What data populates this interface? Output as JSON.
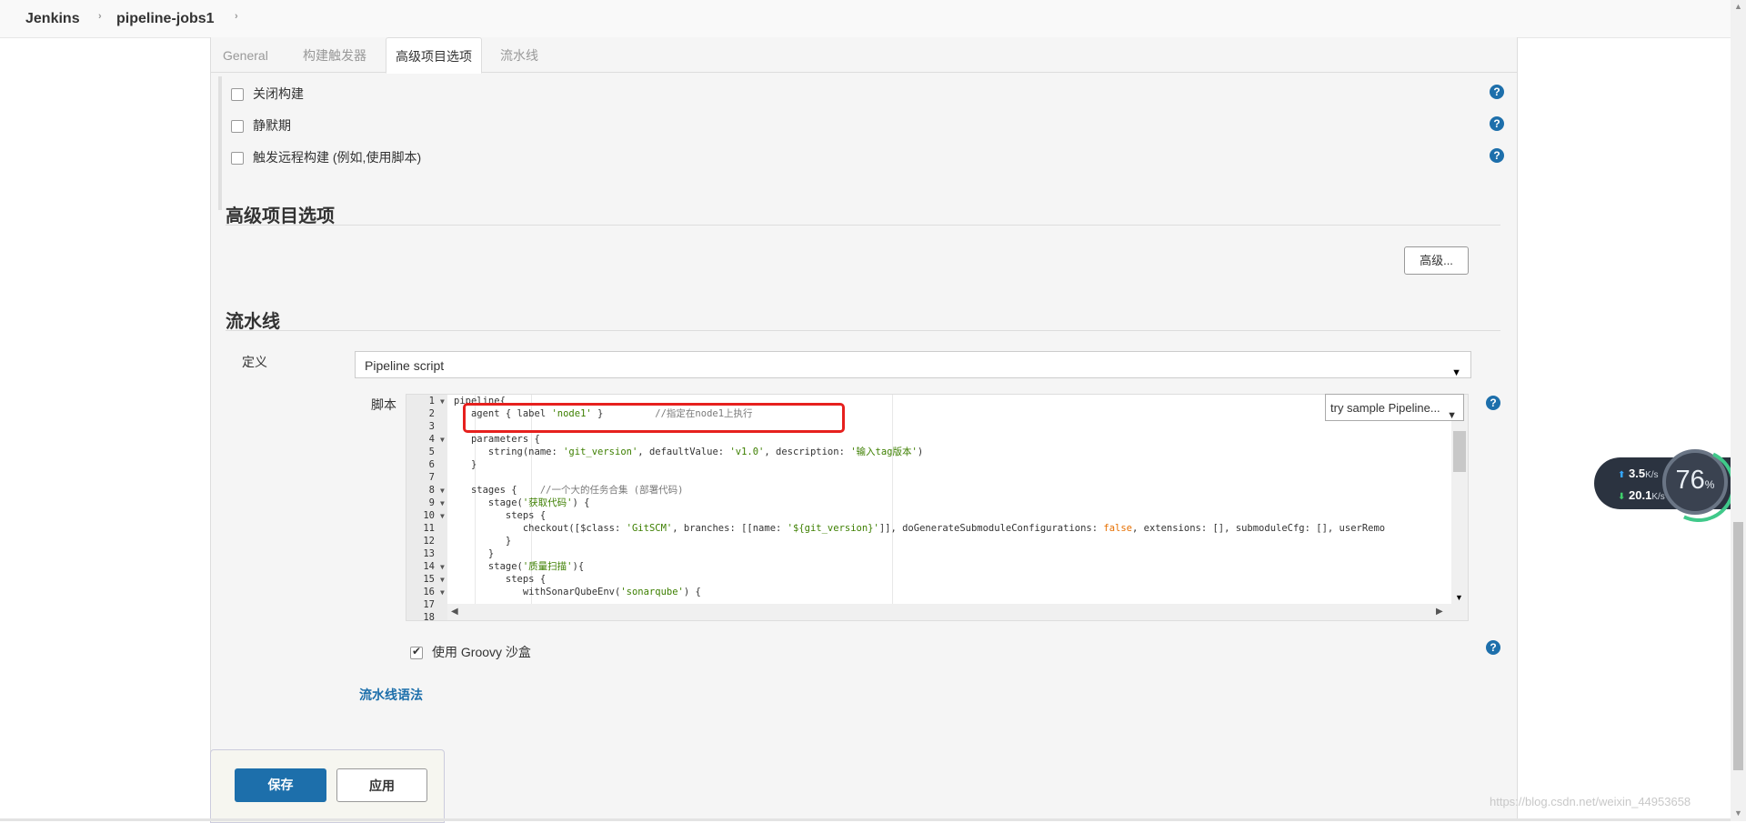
{
  "breadcrumb": {
    "items": [
      "Jenkins",
      "pipeline-jobs1"
    ]
  },
  "tabs": [
    "General",
    "构建触发器",
    "高级项目选项",
    "流水线"
  ],
  "active_tab": "高级项目选项",
  "build_triggers": {
    "options": [
      {
        "label": "关闭构建",
        "checked": false
      },
      {
        "label": "静默期",
        "checked": false
      },
      {
        "label": "触发远程构建 (例如,使用脚本)",
        "checked": false
      }
    ]
  },
  "advanced": {
    "title": "高级项目选项",
    "button": "高级..."
  },
  "pipeline": {
    "title": "流水线",
    "definition_label": "定义",
    "definition_value": "Pipeline script",
    "script_label": "脚本",
    "sample_select": "try sample Pipeline...",
    "code_lines": [
      {
        "n": "1",
        "fold": true,
        "parts": [
          {
            "t": "pipeline{"
          }
        ]
      },
      {
        "n": "2",
        "fold": false,
        "parts": [
          {
            "t": "   agent { label "
          },
          {
            "t": "'node1'",
            "c": "str"
          },
          {
            "t": " }         "
          },
          {
            "t": "//指定在node1上执行",
            "c": "cmt"
          }
        ]
      },
      {
        "n": "3",
        "fold": false,
        "parts": [
          {
            "t": ""
          }
        ]
      },
      {
        "n": "4",
        "fold": true,
        "parts": [
          {
            "t": "   parameters {"
          }
        ]
      },
      {
        "n": "5",
        "fold": false,
        "parts": [
          {
            "t": "      string(name: "
          },
          {
            "t": "'git_version'",
            "c": "str"
          },
          {
            "t": ", defaultValue: "
          },
          {
            "t": "'v1.0'",
            "c": "str"
          },
          {
            "t": ", description: "
          },
          {
            "t": "'输入tag版本'",
            "c": "str"
          },
          {
            "t": ")"
          }
        ]
      },
      {
        "n": "6",
        "fold": false,
        "parts": [
          {
            "t": "   }"
          }
        ]
      },
      {
        "n": "7",
        "fold": false,
        "parts": [
          {
            "t": ""
          }
        ]
      },
      {
        "n": "8",
        "fold": true,
        "parts": [
          {
            "t": "   stages {    "
          },
          {
            "t": "//一个大的任务合集 (部署代码)",
            "c": "cmt"
          }
        ]
      },
      {
        "n": "9",
        "fold": true,
        "parts": [
          {
            "t": "      stage("
          },
          {
            "t": "'获取代码'",
            "c": "str"
          },
          {
            "t": ") {"
          }
        ]
      },
      {
        "n": "10",
        "fold": true,
        "parts": [
          {
            "t": "         steps {"
          }
        ]
      },
      {
        "n": "11",
        "fold": false,
        "parts": [
          {
            "t": "            checkout([$class: "
          },
          {
            "t": "'GitSCM'",
            "c": "str"
          },
          {
            "t": ", branches: [[name: "
          },
          {
            "t": "'${git_version}'",
            "c": "str"
          },
          {
            "t": "]], doGenerateSubmoduleConfigurations: "
          },
          {
            "t": "false",
            "c": "kw"
          },
          {
            "t": ", extensions: [], submoduleCfg: [], userRemo"
          }
        ]
      },
      {
        "n": "12",
        "fold": false,
        "parts": [
          {
            "t": "         }"
          }
        ]
      },
      {
        "n": "13",
        "fold": false,
        "parts": [
          {
            "t": "      }"
          }
        ]
      },
      {
        "n": "14",
        "fold": true,
        "parts": [
          {
            "t": "      stage("
          },
          {
            "t": "'质量扫描'",
            "c": "str"
          },
          {
            "t": "){"
          }
        ]
      },
      {
        "n": "15",
        "fold": true,
        "parts": [
          {
            "t": "         steps {"
          }
        ]
      },
      {
        "n": "16",
        "fold": true,
        "parts": [
          {
            "t": "            withSonarQubeEnv("
          },
          {
            "t": "'sonarqube'",
            "c": "str"
          },
          {
            "t": ") {"
          }
        ]
      },
      {
        "n": "17",
        "fold": false,
        "parts": [
          {
            "t": ""
          }
        ]
      },
      {
        "n": "18",
        "fold": false,
        "parts": [
          {
            "t": ""
          }
        ]
      }
    ],
    "groovy_sandbox": {
      "label": "使用 Groovy 沙盒",
      "checked": true
    },
    "syntax_link": "流水线语法"
  },
  "actions": {
    "save": "保存",
    "apply": "应用"
  },
  "network_widget": {
    "upload": "3.5",
    "upload_unit": "K/s",
    "download": "20.1",
    "download_unit": "K/s",
    "percent": "76",
    "percent_sign": "%"
  },
  "watermark": "https://blog.csdn.net/weixin_44953658"
}
